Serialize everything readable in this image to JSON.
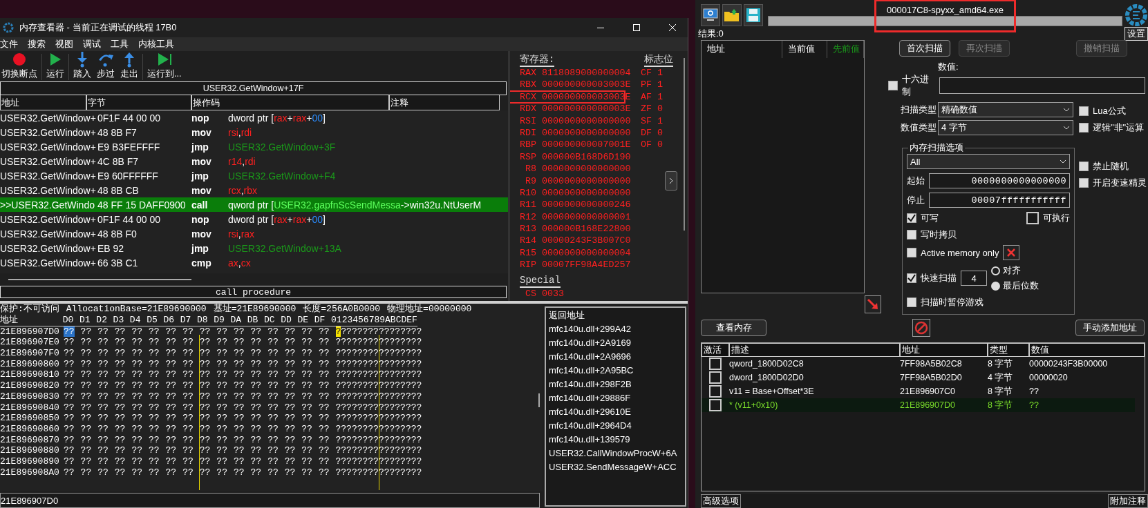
{
  "memory_viewer": {
    "title": "内存查看器 - 当前正在调试的线程 17B0",
    "menu": [
      "文件",
      "搜索",
      "视图",
      "调试",
      "工具",
      "内核工具"
    ],
    "toolbar": [
      {
        "kind": "breakpoint",
        "label": "切换断点"
      },
      {
        "kind": "run",
        "label": "运行"
      },
      {
        "kind": "step-into",
        "label": "踏入"
      },
      {
        "kind": "step-over",
        "label": "步过"
      },
      {
        "kind": "step-out",
        "label": "走出"
      },
      {
        "kind": "run-to",
        "label": "运行到..."
      }
    ],
    "location": "USER32.GetWindow+17F",
    "disasm": {
      "columns": [
        "地址",
        "字节",
        "操作码",
        "注释"
      ],
      "rows": [
        {
          "address": "USER32.GetWindow+",
          "bytes": "0F1F 44 00 00",
          "opcode": "nop",
          "selected": false,
          "operand": [
            {
              "kind": "plain",
              "text": "dword ptr ["
            },
            {
              "kind": "register",
              "text": "rax"
            },
            {
              "kind": "plain",
              "text": "+"
            },
            {
              "kind": "register",
              "text": "rax"
            },
            {
              "kind": "plain",
              "text": "+"
            },
            {
              "kind": "number",
              "text": "00"
            },
            {
              "kind": "plain",
              "text": "]"
            }
          ]
        },
        {
          "address": "USER32.GetWindow+",
          "bytes": "48 8B F7",
          "opcode": "mov",
          "selected": false,
          "operand": [
            {
              "kind": "register",
              "text": "rsi"
            },
            {
              "kind": "plain",
              "text": ","
            },
            {
              "kind": "register",
              "text": "rdi"
            }
          ]
        },
        {
          "address": "USER32.GetWindow+",
          "bytes": "E9 B3FEFFFF",
          "opcode": "jmp",
          "selected": false,
          "operand": [
            {
              "kind": "symbol",
              "text": "USER32.GetWindow+3F"
            }
          ]
        },
        {
          "address": "USER32.GetWindow+",
          "bytes": "4C 8B F7",
          "opcode": "mov",
          "selected": false,
          "operand": [
            {
              "kind": "register",
              "text": "r14"
            },
            {
              "kind": "plain",
              "text": ","
            },
            {
              "kind": "register",
              "text": "rdi"
            }
          ]
        },
        {
          "address": "USER32.GetWindow+",
          "bytes": "E9 60FFFFFF",
          "opcode": "jmp",
          "selected": false,
          "operand": [
            {
              "kind": "symbol",
              "text": "USER32.GetWindow+F4"
            }
          ]
        },
        {
          "address": "USER32.GetWindow+",
          "bytes": "48 8B CB",
          "opcode": "mov",
          "selected": false,
          "operand": [
            {
              "kind": "register",
              "text": "rcx"
            },
            {
              "kind": "plain",
              "text": ","
            },
            {
              "kind": "register",
              "text": "rbx"
            }
          ]
        },
        {
          "address": ">>USER32.GetWindo",
          "bytes": "48 FF 15 DAFF0900",
          "opcode": "call",
          "selected": true,
          "operand": [
            {
              "kind": "plain",
              "text": "qword ptr ["
            },
            {
              "kind": "symbol",
              "text": "USER32.gapfnScSendMessa"
            },
            {
              "kind": "plain",
              "text": "->win32u.NtUserM"
            }
          ]
        },
        {
          "address": "USER32.GetWindow+",
          "bytes": "0F1F 44 00 00",
          "opcode": "nop",
          "selected": false,
          "operand": [
            {
              "kind": "plain",
              "text": "dword ptr ["
            },
            {
              "kind": "register",
              "text": "rax"
            },
            {
              "kind": "plain",
              "text": "+"
            },
            {
              "kind": "register",
              "text": "rax"
            },
            {
              "kind": "plain",
              "text": "+"
            },
            {
              "kind": "number",
              "text": "00"
            },
            {
              "kind": "plain",
              "text": "]"
            }
          ]
        },
        {
          "address": "USER32.GetWindow+",
          "bytes": "48 8B F0",
          "opcode": "mov",
          "selected": false,
          "operand": [
            {
              "kind": "register",
              "text": "rsi"
            },
            {
              "kind": "plain",
              "text": ","
            },
            {
              "kind": "register",
              "text": "rax"
            }
          ]
        },
        {
          "address": "USER32.GetWindow+",
          "bytes": "EB 92",
          "opcode": "jmp",
          "selected": false,
          "operand": [
            {
              "kind": "symbol",
              "text": "USER32.GetWindow+13A"
            }
          ]
        },
        {
          "address": "USER32.GetWindow+",
          "bytes": "66 3B C1",
          "opcode": "cmp",
          "selected": false,
          "operand": [
            {
              "kind": "register",
              "text": "ax"
            },
            {
              "kind": "plain",
              "text": ","
            },
            {
              "kind": "register",
              "text": "cx"
            }
          ]
        }
      ]
    },
    "status": "call procedure",
    "registers_title": "寄存器:",
    "flags_title": "标志位",
    "registers": [
      {
        "name": "RAX",
        "value": "8118089000000004",
        "annotated": false
      },
      {
        "name": "RBX",
        "value": "000000000003003E",
        "annotated": false
      },
      {
        "name": "RCX",
        "value": "000000000003003E",
        "annotated": true
      },
      {
        "name": "RDX",
        "value": "000000000000003E",
        "annotated": false
      },
      {
        "name": "RSI",
        "value": "0000000000000000",
        "annotated": false
      },
      {
        "name": "RDI",
        "value": "0000000000000000",
        "annotated": false
      },
      {
        "name": "RBP",
        "value": "000000000007001E",
        "annotated": false
      },
      {
        "name": "RSP",
        "value": "000000B168D6D190",
        "annotated": false
      },
      {
        "name": "R8",
        "value": "0000000000000000",
        "annotated": false
      },
      {
        "name": "R9",
        "value": "0000000000000000",
        "annotated": false
      },
      {
        "name": "R10",
        "value": "0000000000000000",
        "annotated": false
      },
      {
        "name": "R11",
        "value": "0000000000000246",
        "annotated": false
      },
      {
        "name": "R12",
        "value": "0000000000000001",
        "annotated": false
      },
      {
        "name": "R13",
        "value": "000000B168E22800",
        "annotated": false
      },
      {
        "name": "R14",
        "value": "00000243F3B007C0",
        "annotated": false
      },
      {
        "name": "R15",
        "value": "0000000000000004",
        "annotated": false
      },
      {
        "name": "RIP",
        "value": "00007FF98A4ED257",
        "annotated": false
      }
    ],
    "flags": [
      {
        "name": "CF",
        "value": "1"
      },
      {
        "name": "PF",
        "value": "1"
      },
      {
        "name": "AF",
        "value": "1"
      },
      {
        "name": "ZF",
        "value": "0"
      },
      {
        "name": "SF",
        "value": "1"
      },
      {
        "name": "DF",
        "value": "0"
      },
      {
        "name": "OF",
        "value": "0"
      }
    ],
    "special_title": "Special",
    "special": [
      {
        "name": "CS",
        "value": "0033"
      }
    ],
    "hex": {
      "info": [
        "保护:不可访问",
        "AllocationBase=21E89690000",
        "基址=21E89690000",
        "长度=256A0B0000",
        "物理地址=00000000"
      ],
      "address_header": "地址",
      "columns": [
        "D0",
        "D1",
        "D2",
        "D3",
        "D4",
        "D5",
        "D6",
        "D7",
        "D8",
        "D9",
        "DA",
        "DB",
        "DC",
        "DD",
        "DE",
        "DF"
      ],
      "ascii_header": "0123456789ABCDEF",
      "rows": [
        {
          "address": "21E896907D0",
          "selected": true,
          "bytes": [
            "??",
            "??",
            "??",
            "??",
            "??",
            "??",
            "??",
            "??",
            "??",
            "??",
            "??",
            "??",
            "??",
            "??",
            "??",
            "??"
          ],
          "ascii": "????????????????"
        },
        {
          "address": "21E896907E0",
          "selected": false,
          "bytes": [
            "??",
            "??",
            "??",
            "??",
            "??",
            "??",
            "??",
            "??",
            "??",
            "??",
            "??",
            "??",
            "??",
            "??",
            "??",
            "??"
          ],
          "ascii": "????????????????"
        },
        {
          "address": "21E896907F0",
          "selected": false,
          "bytes": [
            "??",
            "??",
            "??",
            "??",
            "??",
            "??",
            "??",
            "??",
            "??",
            "??",
            "??",
            "??",
            "??",
            "??",
            "??",
            "??"
          ],
          "ascii": "????????????????"
        },
        {
          "address": "21E89690800",
          "selected": false,
          "bytes": [
            "??",
            "??",
            "??",
            "??",
            "??",
            "??",
            "??",
            "??",
            "??",
            "??",
            "??",
            "??",
            "??",
            "??",
            "??",
            "??"
          ],
          "ascii": "????????????????"
        },
        {
          "address": "21E89690810",
          "selected": false,
          "bytes": [
            "??",
            "??",
            "??",
            "??",
            "??",
            "??",
            "??",
            "??",
            "??",
            "??",
            "??",
            "??",
            "??",
            "??",
            "??",
            "??"
          ],
          "ascii": "????????????????"
        },
        {
          "address": "21E89690820",
          "selected": false,
          "bytes": [
            "??",
            "??",
            "??",
            "??",
            "??",
            "??",
            "??",
            "??",
            "??",
            "??",
            "??",
            "??",
            "??",
            "??",
            "??",
            "??"
          ],
          "ascii": "????????????????"
        },
        {
          "address": "21E89690830",
          "selected": false,
          "bytes": [
            "??",
            "??",
            "??",
            "??",
            "??",
            "??",
            "??",
            "??",
            "??",
            "??",
            "??",
            "??",
            "??",
            "??",
            "??",
            "??"
          ],
          "ascii": "????????????????"
        },
        {
          "address": "21E89690840",
          "selected": false,
          "bytes": [
            "??",
            "??",
            "??",
            "??",
            "??",
            "??",
            "??",
            "??",
            "??",
            "??",
            "??",
            "??",
            "??",
            "??",
            "??",
            "??"
          ],
          "ascii": "????????????????"
        },
        {
          "address": "21E89690850",
          "selected": false,
          "bytes": [
            "??",
            "??",
            "??",
            "??",
            "??",
            "??",
            "??",
            "??",
            "??",
            "??",
            "??",
            "??",
            "??",
            "??",
            "??",
            "??"
          ],
          "ascii": "????????????????"
        },
        {
          "address": "21E89690860",
          "selected": false,
          "bytes": [
            "??",
            "??",
            "??",
            "??",
            "??",
            "??",
            "??",
            "??",
            "??",
            "??",
            "??",
            "??",
            "??",
            "??",
            "??",
            "??"
          ],
          "ascii": "????????????????"
        },
        {
          "address": "21E89690870",
          "selected": false,
          "bytes": [
            "??",
            "??",
            "??",
            "??",
            "??",
            "??",
            "??",
            "??",
            "??",
            "??",
            "??",
            "??",
            "??",
            "??",
            "??",
            "??"
          ],
          "ascii": "????????????????"
        },
        {
          "address": "21E89690880",
          "selected": false,
          "bytes": [
            "??",
            "??",
            "??",
            "??",
            "??",
            "??",
            "??",
            "??",
            "??",
            "??",
            "??",
            "??",
            "??",
            "??",
            "??",
            "??"
          ],
          "ascii": "????????????????"
        },
        {
          "address": "21E89690890",
          "selected": false,
          "bytes": [
            "??",
            "??",
            "??",
            "??",
            "??",
            "??",
            "??",
            "??",
            "??",
            "??",
            "??",
            "??",
            "??",
            "??",
            "??",
            "??"
          ],
          "ascii": "????????????????"
        },
        {
          "address": "21E896908A0",
          "selected": false,
          "bytes": [
            "??",
            "??",
            "??",
            "??",
            "??",
            "??",
            "??",
            "??",
            "??",
            "??",
            "??",
            "??",
            "??",
            "??",
            "??",
            "??"
          ],
          "ascii": "????????????????"
        }
      ],
      "address_field": "21E896907D0"
    },
    "call_stack": {
      "header": "返回地址",
      "entries": [
        "mfc140u.dll+299A42",
        "mfc140u.dll+2A9169",
        "mfc140u.dll+2A9696",
        "mfc140u.dll+2A95BC",
        "mfc140u.dll+298F2B",
        "mfc140u.dll+29886F",
        "mfc140u.dll+29610E",
        "mfc140u.dll+2964D4",
        "mfc140u.dll+139579",
        "USER32.CallWindowProcW+6A",
        "USER32.SendMessageW+ACC"
      ]
    }
  },
  "cheat_engine": {
    "process": {
      "text": "000017C8-spyxx_amd64.exe",
      "annotated": true
    },
    "settings": "设置",
    "results": "结果:0",
    "found_columns": [
      "地址",
      "当前值",
      "先前值"
    ],
    "scan_buttons": [
      {
        "label": "首次扫描",
        "disabled": false
      },
      {
        "label": "再次扫描",
        "disabled": true
      },
      {
        "label": "撤销扫描",
        "disabled": true
      }
    ],
    "value_label": "数值:",
    "hex_option": {
      "label": "十六进制",
      "checked": false
    },
    "scan_type": {
      "label": "扫描类型",
      "value": "精确数值"
    },
    "value_type": {
      "label": "数值类型",
      "value": "4 字节"
    },
    "side_options_top": [
      {
        "label": "Lua公式",
        "checked": false
      },
      {
        "label": "逻辑\"非\"运算",
        "checked": false
      }
    ],
    "side_options_bottom": [
      {
        "label": "禁止随机",
        "checked": false
      },
      {
        "label": "开启变速精灵",
        "checked": false
      }
    ],
    "memory_options": {
      "title": "内存扫描选项",
      "region": "All",
      "start_label": "起始",
      "start": "0000000000000000",
      "stop_label": "停止",
      "stop": "00007fffffffffff",
      "writable": {
        "label": "可写",
        "checked": true
      },
      "executable": {
        "label": "可执行",
        "checked": false
      },
      "copy_on_write": {
        "label": "写时拷贝",
        "checked": false
      },
      "active_only": {
        "label": "Active memory only",
        "checked": false
      },
      "fast_scan": {
        "label": "快速扫描",
        "checked": true,
        "value": "4"
      },
      "alignment": [
        {
          "label": "对齐",
          "selected": false
        },
        {
          "label": "最后位数",
          "selected": true
        }
      ],
      "pause": {
        "label": "扫描时暂停游戏",
        "checked": false
      }
    },
    "view_memory": "查看内存",
    "add_address": "手动添加地址",
    "table": {
      "columns": [
        "激活",
        "描述",
        "地址",
        "类型",
        "数值"
      ],
      "rows": [
        {
          "active": false,
          "selected": false,
          "description": "qword_1800D02C8",
          "address": "7FF98A5B02C8",
          "type": "8 字节",
          "value": "00000243F3B00000"
        },
        {
          "active": false,
          "selected": false,
          "description": "dword_1800D02D0",
          "address": "7FF98A5B02D0",
          "type": "4 字节",
          "value": "00000020"
        },
        {
          "active": false,
          "selected": false,
          "description": "v11 = Base+Offset*3E",
          "address": "21E896907C0",
          "type": "8 字节",
          "value": "??"
        },
        {
          "active": false,
          "selected": true,
          "description": "*  (v11+0x10)",
          "address": "21E896907D0",
          "type": "8 字节",
          "value": "??"
        }
      ]
    },
    "advanced": "高级选项",
    "comments": "附加注释"
  }
}
